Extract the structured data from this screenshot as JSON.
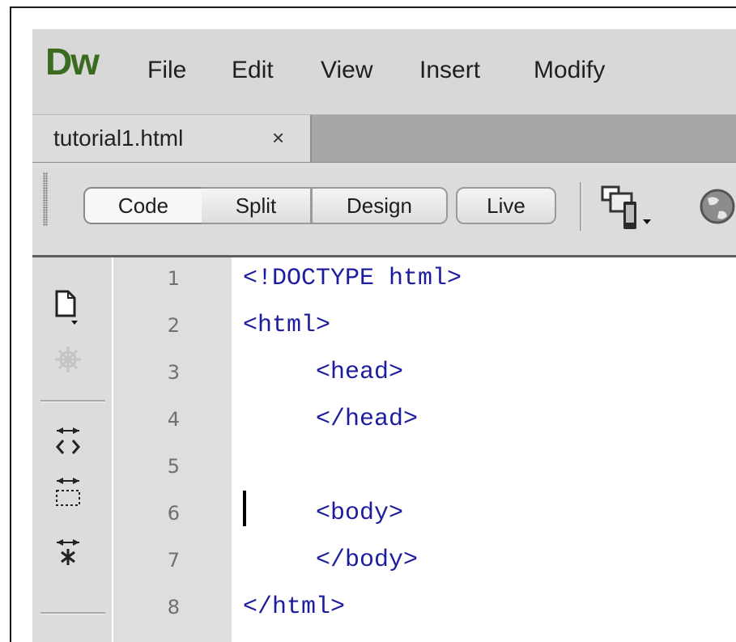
{
  "app": {
    "logo": "Dw",
    "menu": [
      "File",
      "Edit",
      "View",
      "Insert",
      "Modify"
    ]
  },
  "tabs": [
    {
      "label": "tutorial1.html",
      "close_glyph": "×",
      "active": true
    }
  ],
  "view_buttons": {
    "code": "Code",
    "split": "Split",
    "design": "Design",
    "live": "Live",
    "selected": "Code"
  },
  "toolbar_icons": [
    "multiscreen-preview-icon",
    "preview-in-browser-icon"
  ],
  "coding_toolbar_icons": [
    "open-documents-icon",
    "show-code-navigator-icon",
    "collapse-full-tag-icon",
    "collapse-selection-icon",
    "expand-all-icon"
  ],
  "editor": {
    "line_numbers": [
      "1",
      "2",
      "3",
      "4",
      "5",
      "6",
      "7",
      "8"
    ],
    "lines": [
      "<!DOCTYPE html>",
      "<html>",
      "     <head>",
      "     </head>",
      "",
      "     <body>",
      "     </body>",
      "</html>"
    ],
    "caret_line": 6,
    "code_color": "#1c1c9e"
  },
  "colors": {
    "logo": "#3a6b1f",
    "chrome": "#d8d8d8",
    "tabstrip": "#a7a7a7"
  }
}
